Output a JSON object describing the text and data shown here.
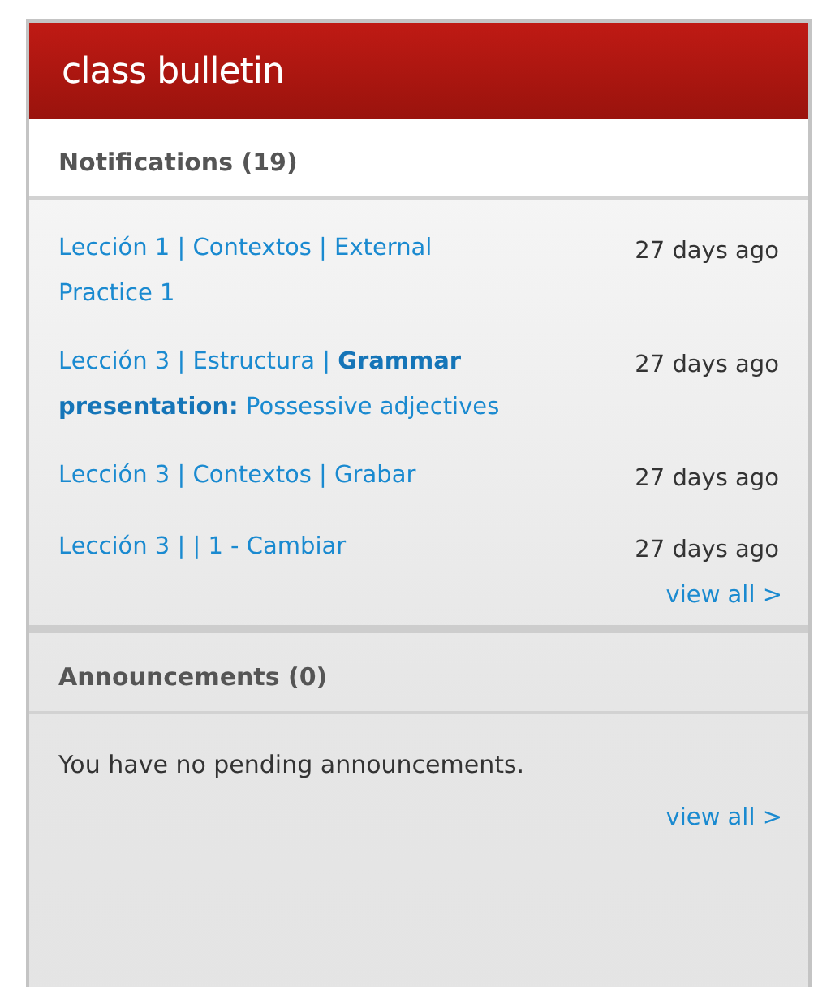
{
  "panel": {
    "title": "class bulletin"
  },
  "notifications": {
    "heading": "Notifications (19)",
    "items": [
      {
        "text": "Lección 1 | Contextos | External Practice 1",
        "time": "27 days ago"
      },
      {
        "text": "Lección 3 | Estructura | **Grammar presentation:** Possessive adjectives",
        "time": "27 days ago"
      },
      {
        "text": "Lección 3 | Contextos | Grabar",
        "time": "27 days ago"
      },
      {
        "text": "Lección 3 | | 1 - Cambiar",
        "time": "27 days ago"
      }
    ],
    "view_all": "view all >"
  },
  "announcements": {
    "heading": "Announcements (0)",
    "message": "You have no pending announcements.",
    "view_all": "view all >"
  }
}
